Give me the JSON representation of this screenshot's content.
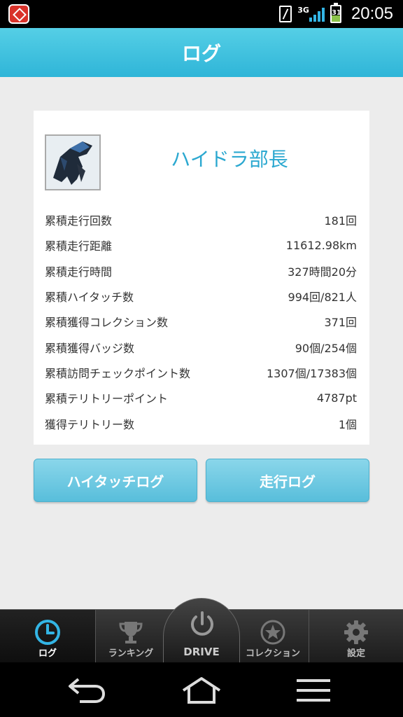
{
  "status_bar": {
    "network": "3G",
    "battery": "31",
    "time": "20:05"
  },
  "header": {
    "title": "ログ"
  },
  "profile": {
    "name": "ハイドラ部長"
  },
  "stats": [
    {
      "label": "累積走行回数",
      "value": "181回"
    },
    {
      "label": "累積走行距離",
      "value": "11612.98km"
    },
    {
      "label": "累積走行時間",
      "value": "327時間20分"
    },
    {
      "label": "累積ハイタッチ数",
      "value": "994回/821人"
    },
    {
      "label": "累積獲得コレクション数",
      "value": "371回"
    },
    {
      "label": "累積獲得バッジ数",
      "value": "90個/254個"
    },
    {
      "label": "累積訪問チェックポイント数",
      "value": "1307個/17383個"
    },
    {
      "label": "累積テリトリーポイント",
      "value": "4787pt"
    },
    {
      "label": "獲得テリトリー数",
      "value": "1個"
    }
  ],
  "buttons": {
    "hightouch_log": "ハイタッチログ",
    "drive_log": "走行ログ"
  },
  "tabs": {
    "log": "ログ",
    "ranking": "ランキング",
    "drive": "DRIVE",
    "collection": "コレクション",
    "settings": "設定"
  },
  "colors": {
    "accent": "#33b5e5",
    "header": "#2fb5d8",
    "username": "#2ba8d0"
  }
}
